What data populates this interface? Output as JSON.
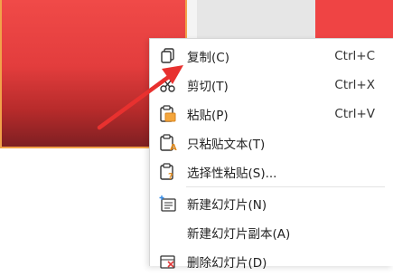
{
  "menu": {
    "items": [
      {
        "label": "复制(C)",
        "shortcut": "Ctrl+C",
        "icon": "copy-icon"
      },
      {
        "label": "剪切(T)",
        "shortcut": "Ctrl+X",
        "icon": "scissors-icon"
      },
      {
        "label": "粘贴(P)",
        "shortcut": "Ctrl+V",
        "icon": "paste-icon"
      },
      {
        "label": "只粘贴文本(T)",
        "shortcut": "",
        "icon": "paste-text-icon"
      },
      {
        "label": "选择性粘贴(S)...",
        "shortcut": "",
        "icon": "paste-special-icon"
      },
      {
        "label": "新建幻灯片(N)",
        "shortcut": "",
        "icon": "new-slide-icon"
      },
      {
        "label": "新建幻灯片副本(A)",
        "shortcut": "",
        "icon": ""
      },
      {
        "label": "删除幻灯片(D)",
        "shortcut": "",
        "icon": "delete-slide-icon"
      }
    ]
  },
  "colors": {
    "slide_red": "#ef4444",
    "arrow_red": "#e8312f",
    "thumb_border": "#f1a24a"
  }
}
